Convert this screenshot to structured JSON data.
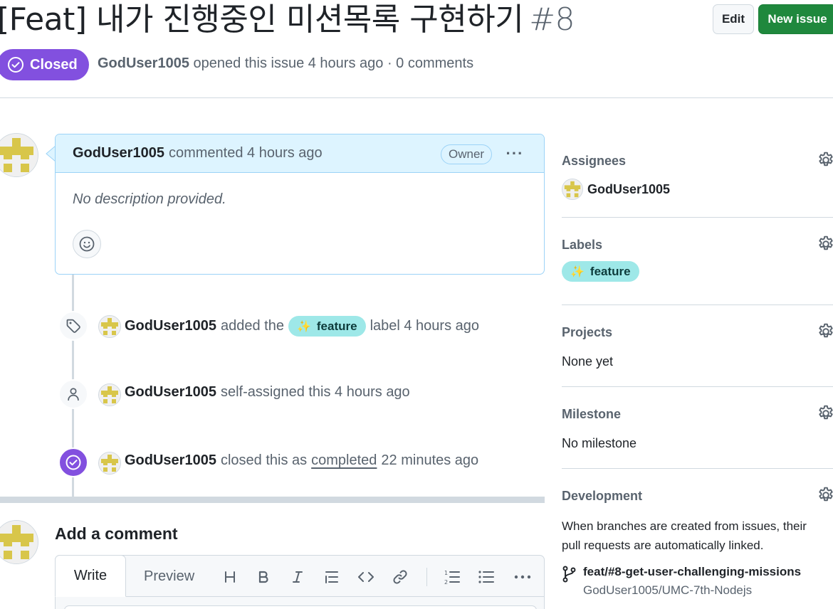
{
  "issue": {
    "title": "[Feat] 내가 진행중인 미션목록 구현하기",
    "number": "#8",
    "state": "Closed",
    "author": "GodUser1005",
    "meta": "opened this issue 4 hours ago · 0 comments"
  },
  "header_buttons": {
    "edit": "Edit",
    "new_issue": "New issue"
  },
  "comment": {
    "author": "GodUser1005",
    "action": "commented 4 hours ago",
    "role_badge": "Owner",
    "menu": "···",
    "body": "No description provided."
  },
  "timeline": [
    {
      "icon": "tag-icon",
      "author": "GodUser1005",
      "pre": "added the",
      "label": "feature",
      "post": "label 4 hours ago"
    },
    {
      "icon": "person-icon",
      "author": "GodUser1005",
      "text": "self-assigned this 4 hours ago"
    },
    {
      "icon": "check-circle-icon",
      "author": "GodUser1005",
      "pre": "closed this as",
      "link": "completed",
      "post": "22 minutes ago"
    }
  ],
  "add_comment": {
    "title": "Add a comment",
    "tabs": [
      "Write",
      "Preview"
    ],
    "toolbar": [
      "H",
      "B",
      "I",
      "quote",
      "code",
      "link",
      "ordered-list",
      "unordered-list",
      "more"
    ]
  },
  "sidebar": {
    "assignees": {
      "heading": "Assignees",
      "user": "GodUser1005"
    },
    "labels": {
      "heading": "Labels",
      "label": "feature"
    },
    "projects": {
      "heading": "Projects",
      "value": "None yet"
    },
    "milestone": {
      "heading": "Milestone",
      "value": "No milestone"
    },
    "development": {
      "heading": "Development",
      "text": "When branches are created from issues, their pull requests are automatically linked.",
      "branch": "feat/#8-get-user-challenging-missions",
      "repo": "GodUser1005/UMC-7th-Nodejs"
    }
  },
  "colors": {
    "closed": "#8250df",
    "primary_button": "#1f883d",
    "label_bg": "#9ee8e8",
    "comment_header_bg": "#ddf4ff",
    "border": "#d1d9e0",
    "muted_text": "#59636e"
  }
}
